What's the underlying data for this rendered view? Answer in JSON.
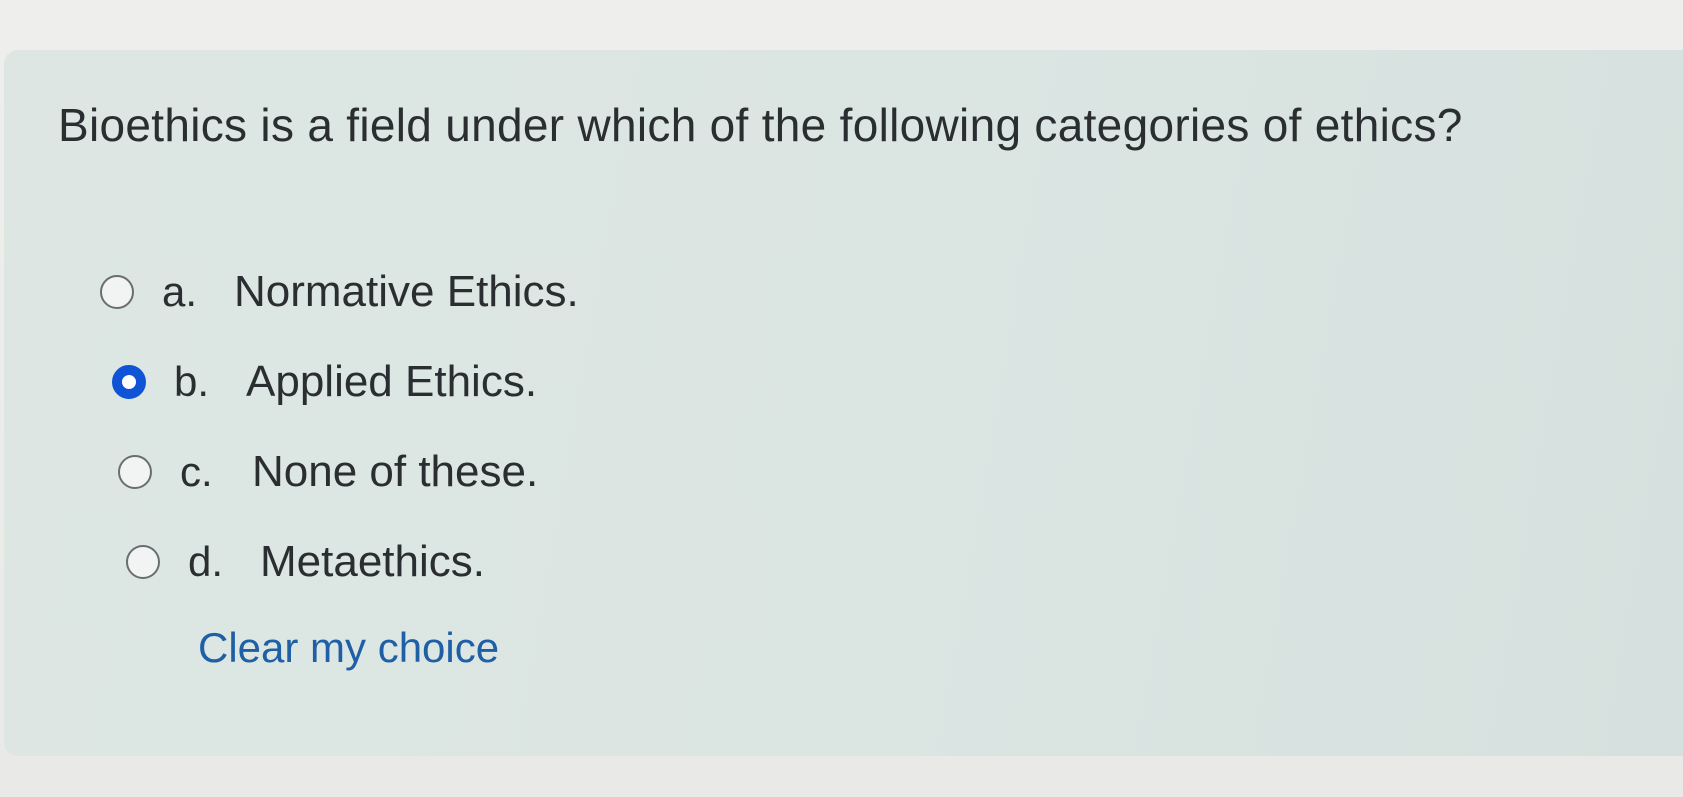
{
  "question": {
    "text": "Bioethics is a field under which of the following categories of ethics?"
  },
  "options": [
    {
      "letter": "a.",
      "label": "Normative Ethics.",
      "selected": false
    },
    {
      "letter": "b.",
      "label": "Applied Ethics.",
      "selected": true
    },
    {
      "letter": "c.",
      "label": "None of these.",
      "selected": false
    },
    {
      "letter": "d.",
      "label": "Metaethics.",
      "selected": false
    }
  ],
  "clear_choice": {
    "label": "Clear my choice"
  },
  "colors": {
    "selected_radio": "#0f54d6",
    "link": "#1e5fa6",
    "card_background": "#dde6e3"
  }
}
